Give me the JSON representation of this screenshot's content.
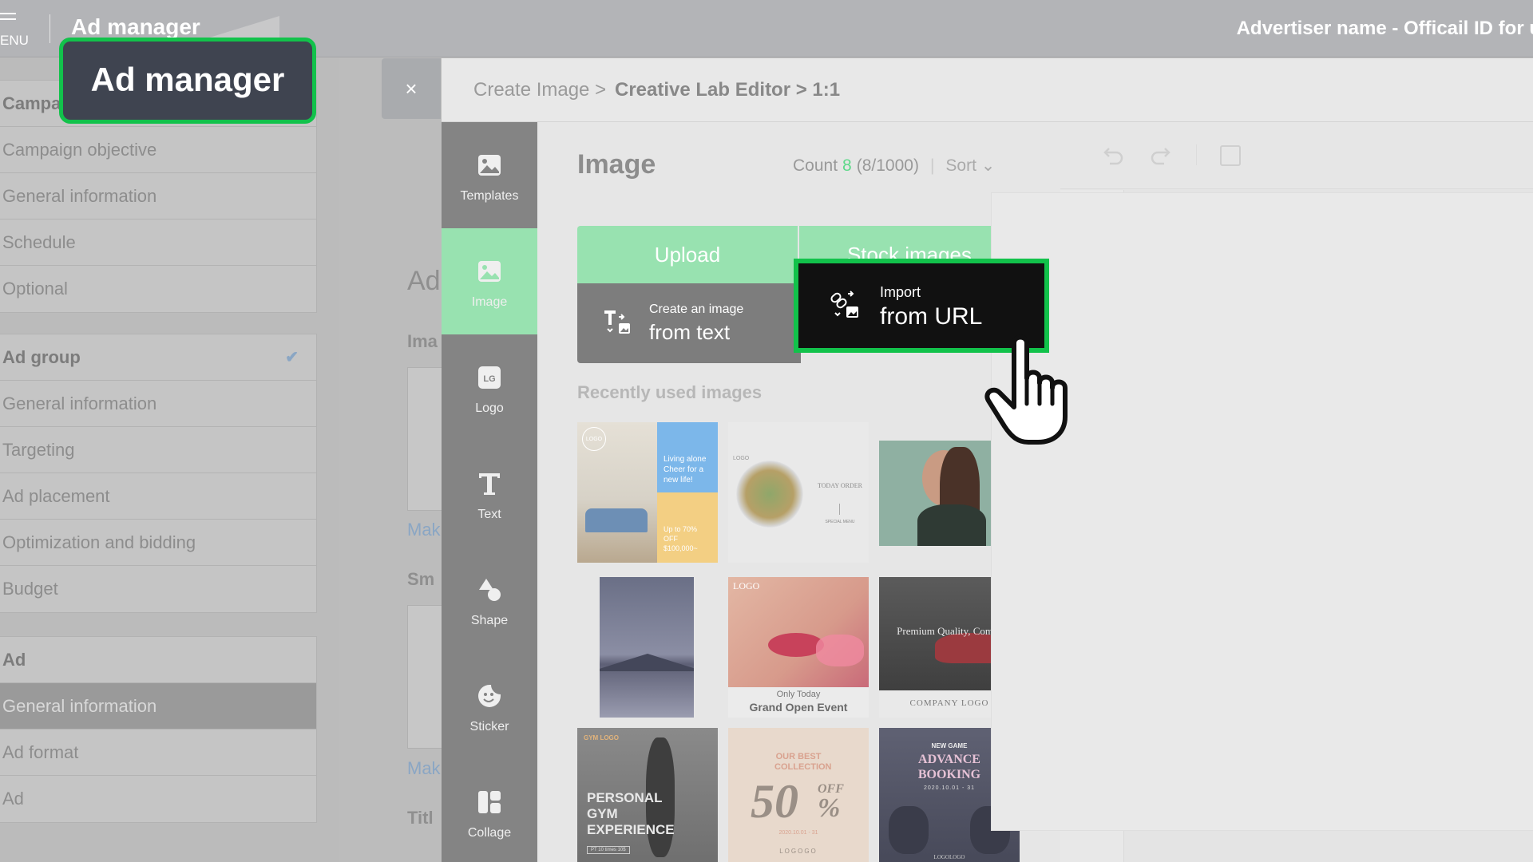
{
  "topbar": {
    "menu_label": "ENU",
    "app_title": "Ad manager",
    "advertiser": "Advertiser name - Officail ID for u"
  },
  "tooltip": {
    "label": "Ad manager"
  },
  "nav": {
    "campaign_header": "Campa",
    "campaign_items": [
      "Campaign objective",
      "General information",
      "Schedule",
      "Optional"
    ],
    "adgroup_header": "Ad group",
    "adgroup_items": [
      "General information",
      "Targeting",
      "Ad placement",
      "Optimization and bidding",
      "Budget"
    ],
    "ad_header": "Ad",
    "ad_items": [
      "General information",
      "Ad format",
      "Ad"
    ]
  },
  "background": {
    "heading": "Ad",
    "label_image": "Ima",
    "link_make": "Mak",
    "label_small": "Sm",
    "link_make2": "Mak",
    "label_title": "Titl"
  },
  "editor": {
    "close": "×",
    "breadcrumb_1": "Create Image >",
    "breadcrumb_2": "Creative Lab Editor > 1:1",
    "sidebar": [
      "Templates",
      "Image",
      "Logo",
      "Text",
      "Shape",
      "Sticker",
      "Collage"
    ],
    "panel_title": "Image",
    "count_label": "Count",
    "count_value": "8",
    "count_total": "(8/1000)",
    "sort_label": "Sort",
    "tab_upload": "Upload",
    "tab_stock": "Stock images",
    "text_btn_line1": "Create an image",
    "text_btn_line2": "from text",
    "url_btn_line1": "Import",
    "url_btn_line2": "from URL",
    "recent_label": "Recently used images"
  },
  "thumbs": {
    "t1_logo": "LOGO",
    "t1_text": "Living alone Cheer for a new life!",
    "t1_offer": "Up to 70% OFF $100,000~",
    "t2_logo": "LOGO",
    "t2_order": "TODAY ORDER",
    "t2_menu": "SPECIAL MENU",
    "t5_logo": "LOGO",
    "t5_sub": "Only Today",
    "t5_title": "Grand Open Event",
    "t6_title": "Premium Quality, Comfy",
    "t6_logo": "COMPANY LOGO",
    "t7_brand": "GYM LOGO",
    "t7_title": "PERSONAL GYM EXPERIENCE",
    "t7_badge": "PT 10 times 10$",
    "t8_title": "OUR BEST COLLECTION",
    "t8_big": "50",
    "t8_off": "OFF",
    "t8_pct": "%",
    "t8_date": "2020.10.01 - 31",
    "t8_logo": "LOGOGO",
    "t9_new": "NEW GAME",
    "t9_title": "ADVANCE BOOKING",
    "t9_date": "2020.10.01 - 31",
    "t9_logo": "LOGOLOGO"
  }
}
